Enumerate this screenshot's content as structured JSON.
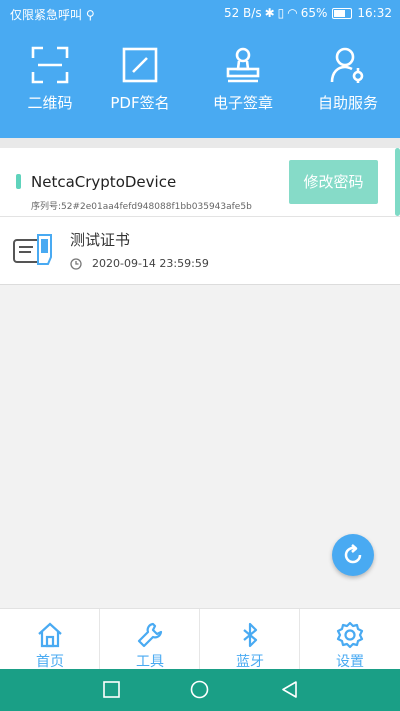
{
  "status_bar": {
    "carrier": "仅限紧急呼叫 ⚲",
    "net_speed": "52 B/s",
    "battery": "65%",
    "time": "16:32"
  },
  "tools": [
    {
      "label": "二维码",
      "icon": "qr-scan-icon"
    },
    {
      "label": "PDF签名",
      "icon": "pdf-sign-icon"
    },
    {
      "label": "电子签章",
      "icon": "stamp-icon"
    },
    {
      "label": "自助服务",
      "icon": "self-service-icon"
    }
  ],
  "device": {
    "name": "NetcaCryptoDevice",
    "serial": "序列号:52#2e01aa4fefd948088f1bb035943afe5b",
    "change_password_label": "修改密码"
  },
  "certificate": {
    "title": "测试证书",
    "date": "2020-09-14 23:59:59"
  },
  "tabs": [
    {
      "label": "首页",
      "icon": "home-icon"
    },
    {
      "label": "工具",
      "icon": "wrench-icon"
    },
    {
      "label": "蓝牙",
      "icon": "bluetooth-icon"
    },
    {
      "label": "设置",
      "icon": "gear-icon"
    }
  ],
  "colors": {
    "primary": "#49aaf2",
    "accent": "#5fd3bc",
    "button": "#86dbc8",
    "navbar": "#1a9f86"
  }
}
